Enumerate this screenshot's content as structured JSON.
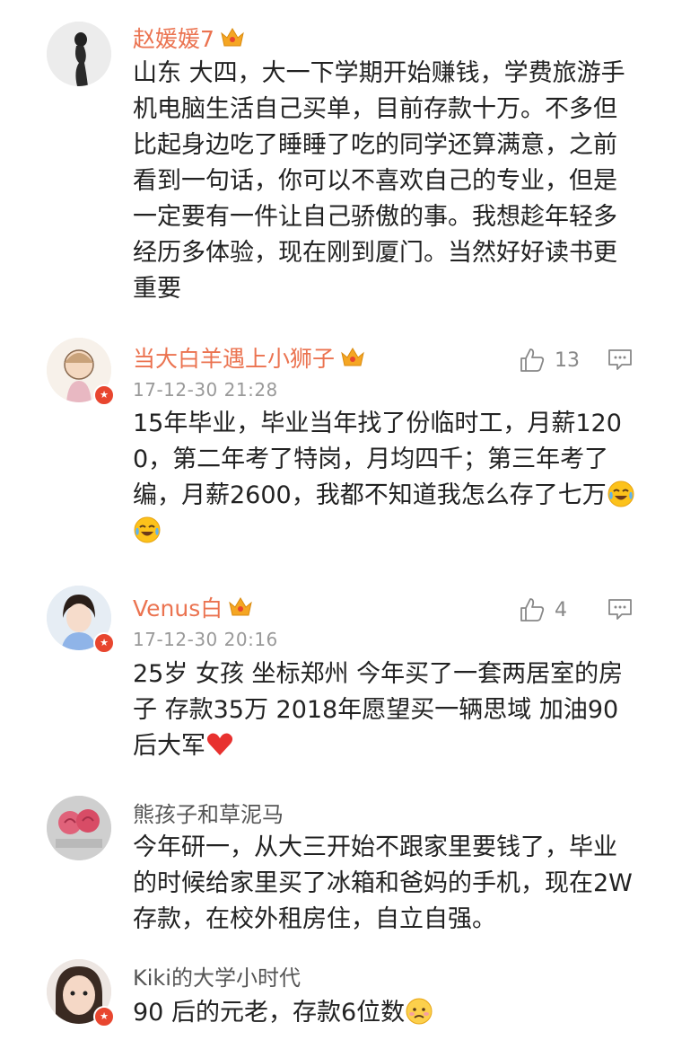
{
  "comments": [
    {
      "name": "赵媛媛7",
      "text": "山东 大四，大一下学期开始赚钱，学费旅游手机电脑生活自己买单，目前存款十万。不多但比起身边吃了睡睡了吃的同学还算满意，之前看到一句话，你可以不喜欢自己的专业，但是一定要有一件让自己骄傲的事。我想趁年轻多经历多体验，现在刚到厦门。当然好好读书更重要"
    },
    {
      "name": "当大白羊遇上小狮子",
      "date": "17-12-30 21:28",
      "likes": "13",
      "text": "15年毕业，毕业当年找了份临时工，月薪1200，第二年考了特岗，月均四千；第三年考了编，月薪2600，我都不知道我怎么存了七万"
    },
    {
      "name": "Venus白",
      "date": "17-12-30 20:16",
      "likes": "4",
      "text": "25岁 女孩 坐标郑州 今年买了一套两居室的房子 存款35万 2018年愿望买一辆思域 加油90后大军"
    },
    {
      "name": "熊孩子和草泥马",
      "text": "今年研一，从大三开始不跟家里要钱了，毕业的时候给家里买了冰箱和爸妈的手机，现在2W存款，在校外租房住，自立自强。"
    },
    {
      "name": "Kiki的大学小时代",
      "text": "90 后的元老，存款6位数"
    }
  ],
  "icons": {
    "crown": "vip-crown-icon",
    "like": "thumbs-up-icon",
    "reply": "comment-bubble-icon",
    "verified": "verified-badge-icon",
    "cry_laugh": "tears-of-joy-emoji",
    "heart": "red-heart-emoji",
    "worried": "worried-face-emoji"
  },
  "colors": {
    "vip_name": "#eb7350",
    "plain_name": "#555555",
    "date": "#999999",
    "badge": "#e8462f"
  }
}
